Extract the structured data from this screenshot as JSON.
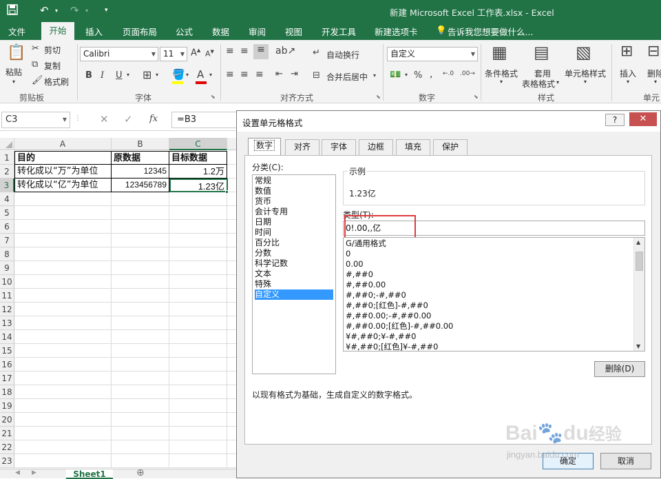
{
  "window": {
    "title": "新建 Microsoft Excel 工作表.xlsx - Excel"
  },
  "ribbon_tabs": [
    "文件",
    "开始",
    "插入",
    "页面布局",
    "公式",
    "数据",
    "审阅",
    "视图",
    "开发工具",
    "新建选项卡"
  ],
  "tell_me": "告诉我您想要做什么...",
  "clipboard": {
    "paste": "粘贴",
    "cut": "剪切",
    "copy": "复制",
    "painter": "格式刷",
    "label": "剪贴板"
  },
  "font": {
    "name": "Calibri",
    "size": "11",
    "label": "字体",
    "bold": "B",
    "italic": "I",
    "underline": "U"
  },
  "alignment": {
    "wrap": "自动换行",
    "merge": "合并后居中",
    "label": "对齐方式"
  },
  "number": {
    "format": "自定义",
    "label": "数字"
  },
  "styles": {
    "conditional": "条件格式",
    "table_line1": "套用",
    "table_line2": "表格格式",
    "cell_styles": "单元格样式",
    "label": "样式"
  },
  "cells": {
    "insert": "插入",
    "delete": "删除",
    "label": "单元"
  },
  "formula_bar": {
    "name_box": "C3",
    "fx": "fx",
    "formula": "=B3"
  },
  "sheet": {
    "columns": [
      "A",
      "B",
      "C"
    ],
    "rows": [
      "1",
      "2",
      "3",
      "4",
      "5",
      "6",
      "7",
      "8",
      "9",
      "10",
      "11",
      "12",
      "13",
      "14",
      "15",
      "16",
      "17",
      "18",
      "19",
      "20",
      "21",
      "22",
      "23"
    ],
    "data": [
      [
        "目的",
        "原数据",
        "目标数据"
      ],
      [
        "转化成以“万”为单位",
        "12345",
        "1.2万"
      ],
      [
        "转化成以“亿”为单位",
        "123456789",
        "1.23亿"
      ]
    ],
    "tab": "Sheet1"
  },
  "dialog": {
    "title": "设置单元格格式",
    "help": "?",
    "tabs": [
      "数字",
      "对齐",
      "字体",
      "边框",
      "填充",
      "保护"
    ],
    "category_label": "分类(C):",
    "categories": [
      "常规",
      "数值",
      "货币",
      "会计专用",
      "日期",
      "时间",
      "百分比",
      "分数",
      "科学记数",
      "文本",
      "特殊",
      "自定义"
    ],
    "selected_category": "自定义",
    "sample_label": "示例",
    "sample_value": "1.23亿",
    "type_label": "类型(T):",
    "type_value": "0!.00,,亿",
    "formats": [
      "G/通用格式",
      "0",
      "0.00",
      "#,##0",
      "#,##0.00",
      "#,##0;-#,##0",
      "#,##0;[红色]-#,##0",
      "#,##0.00;-#,##0.00",
      "#,##0.00;[红色]-#,##0.00",
      "¥#,##0;¥-#,##0",
      "¥#,##0;[红色]¥-#,##0"
    ],
    "delete": "删除(D)",
    "description": "以现有格式为基础，生成自定义的数字格式。",
    "ok": "确定",
    "cancel": "取消"
  },
  "watermark": {
    "brand": "Bai",
    "brand2": "du",
    "brand_cn": "经验",
    "url": "jingyan.baidu.com"
  },
  "colors": {
    "excel_green": "#217346",
    "highlight_red": "#e0393e",
    "selection_blue": "#3399ff"
  }
}
